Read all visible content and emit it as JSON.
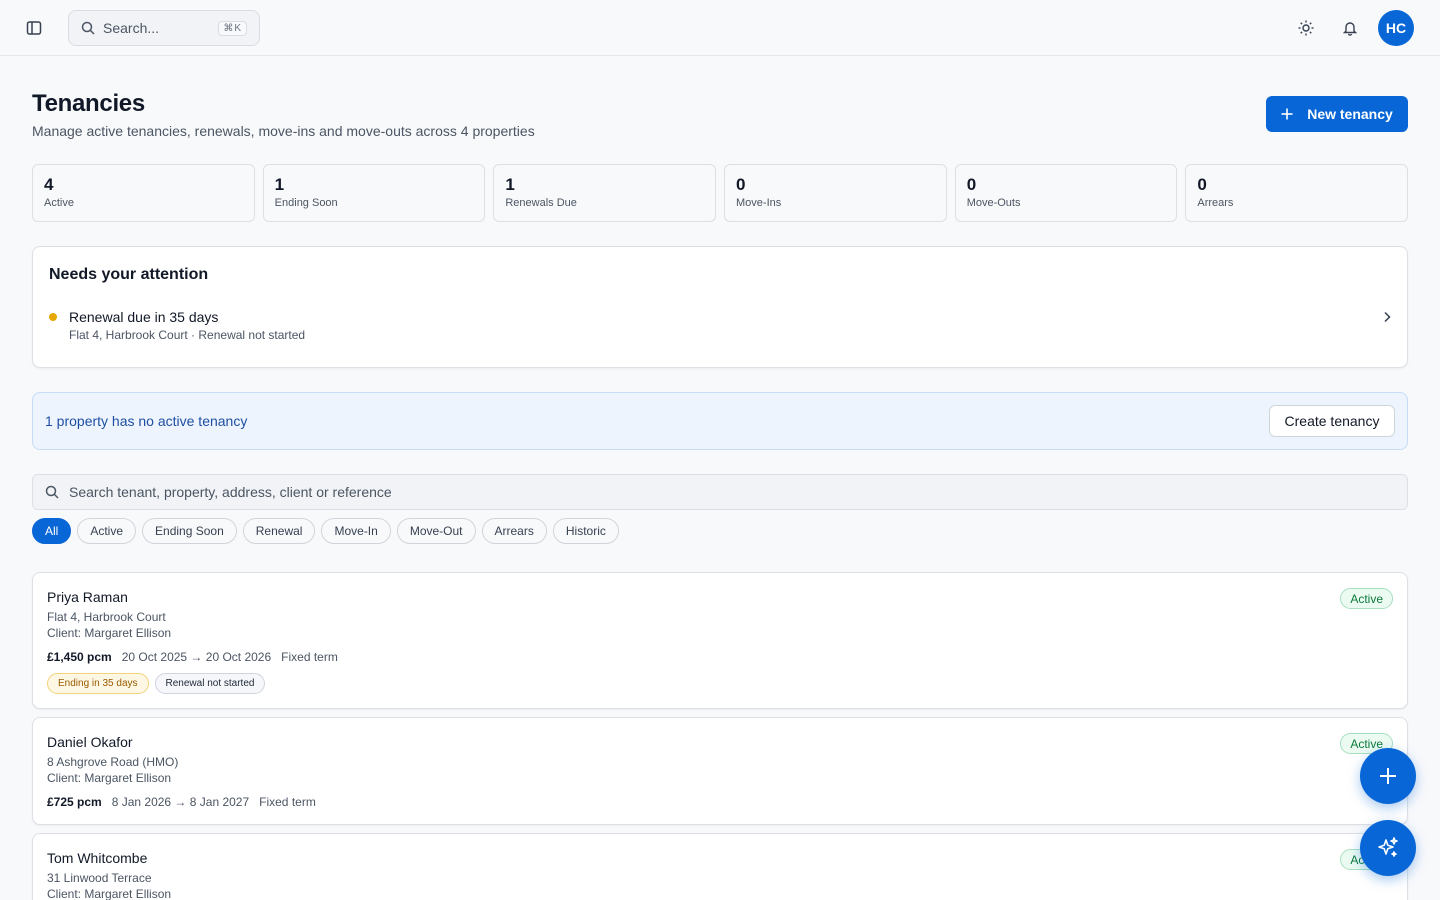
{
  "topbar": {
    "search_placeholder": "Search...",
    "search_shortcut": "⌘K",
    "avatar_initials": "HC",
    "icons": [
      "sidebar-toggle-icon",
      "search-icon",
      "sun-icon",
      "bell-icon"
    ]
  },
  "header": {
    "title": "Tenancies",
    "subtitle": "Manage active tenancies, renewals, move-ins and move-outs across 4 properties",
    "new_button_label": "New tenancy"
  },
  "stats": [
    {
      "value": "4",
      "label": "Active"
    },
    {
      "value": "1",
      "label": "Ending Soon"
    },
    {
      "value": "1",
      "label": "Renewals Due"
    },
    {
      "value": "0",
      "label": "Move-Ins"
    },
    {
      "value": "0",
      "label": "Move-Outs"
    },
    {
      "value": "0",
      "label": "Arrears"
    }
  ],
  "attention": {
    "title": "Needs your attention",
    "items": [
      {
        "title": "Renewal due in 35 days",
        "detail": "Flat 4, Harbrook Court · Renewal not started"
      }
    ]
  },
  "banner": {
    "text": "1 property has no active tenancy",
    "button_label": "Create tenancy"
  },
  "list_search": {
    "placeholder": "Search tenant, property, address, client or reference"
  },
  "filters": [
    {
      "label": "All",
      "active": true
    },
    {
      "label": "Active",
      "active": false
    },
    {
      "label": "Ending Soon",
      "active": false
    },
    {
      "label": "Renewal",
      "active": false
    },
    {
      "label": "Move-In",
      "active": false
    },
    {
      "label": "Move-Out",
      "active": false
    },
    {
      "label": "Arrears",
      "active": false
    },
    {
      "label": "Historic",
      "active": false
    }
  ],
  "tenancies": [
    {
      "tenant": "Priya Raman",
      "property": "Flat 4, Harbrook Court",
      "client": "Client: Margaret Ellison",
      "rent": "£1,450 pcm",
      "dates": "20 Oct 2025 → 20 Oct 2026",
      "term": "Fixed term",
      "status": "Active",
      "tags": [
        {
          "label": "Ending in 35 days",
          "kind": "warn"
        },
        {
          "label": "Renewal not started",
          "kind": "neutral"
        }
      ]
    },
    {
      "tenant": "Daniel Okafor",
      "property": "8 Ashgrove Road (HMO)",
      "client": "Client: Margaret Ellison",
      "rent": "£725 pcm",
      "dates": "8 Jan 2026 → 8 Jan 2027",
      "term": "Fixed term",
      "status": "Active",
      "tags": []
    },
    {
      "tenant": "Tom Whitcombe",
      "property": "31 Linwood Terrace",
      "client": "Client: Margaret Ellison",
      "status": "Active"
    }
  ],
  "colors": {
    "accent": "#0866d6",
    "attention_dot": "#e6a700",
    "status_active": "#0b7a3b",
    "banner_bg": "#edf4fd"
  }
}
